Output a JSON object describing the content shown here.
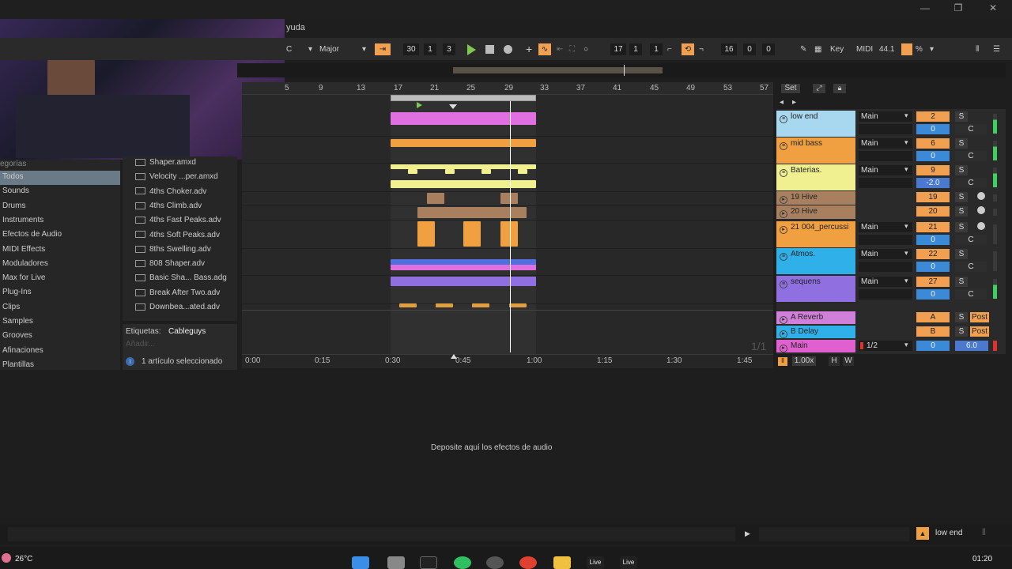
{
  "window": {
    "menu_fragment": "yuda",
    "min": "—",
    "restore": "❐",
    "close": "✕"
  },
  "toolbar": {
    "key": "C",
    "scale": "Major",
    "position": [
      "30",
      "1",
      "3"
    ],
    "loop_start": [
      "17",
      "1",
      "1"
    ],
    "loop_length": [
      "16",
      "0",
      "0"
    ],
    "key_label": "Key",
    "midi_label": "MIDI",
    "cpu": "44.1",
    "cpu_unit": "%"
  },
  "ruler": {
    "bars": [
      "5",
      "9",
      "13",
      "17",
      "21",
      "25",
      "29",
      "33",
      "37",
      "41",
      "45",
      "49",
      "53",
      "57"
    ],
    "set_label": "Set"
  },
  "timeline": {
    "ticks": [
      "0:00",
      "0:15",
      "0:30",
      "0:45",
      "1:00",
      "1:15",
      "1:30",
      "1:45"
    ],
    "page": "1/1"
  },
  "browser": {
    "header": "egorías",
    "categories": [
      "Todos",
      "Sounds",
      "Drums",
      "Instruments",
      "Efectos de Audio",
      "MIDI Effects",
      "Moduladores",
      "Max for Live",
      "Plug-Ins",
      "Clips",
      "Samples",
      "Grooves",
      "Afinaciones",
      "Plantillas"
    ],
    "files": [
      "Shaper.amxd",
      "Velocity ...per.amxd",
      "4ths Choker.adv",
      "4ths Climb.adv",
      "4ths Fast Peaks.adv",
      "4ths Soft Peaks.adv",
      "8ths Swelling.adv",
      "808 Shaper.adv",
      "Basic Sha... Bass.adg",
      "Break After Two.adv",
      "Downbea...ated.adv"
    ],
    "tags_label": "Etiquetas:",
    "tags_value": "Cableguys",
    "add_placeholder": "Añadir...",
    "selected": "1 artículo seleccionado"
  },
  "tracks": [
    {
      "name": "low end",
      "color": "#a8d8f0",
      "route": "Main",
      "num": "2",
      "vol": "0"
    },
    {
      "name": "mid bass",
      "color": "#f0a040",
      "route": "Main",
      "num": "6",
      "vol": "0"
    },
    {
      "name": "Baterias.",
      "color": "#f0f090",
      "route": "Main",
      "num": "9",
      "vol": "-2.0"
    },
    {
      "name": "19 Hive",
      "color": "#a88060",
      "route": "",
      "num": "19",
      "vol": ""
    },
    {
      "name": "20 Hive",
      "color": "#a88060",
      "route": "",
      "num": "20",
      "vol": ""
    },
    {
      "name": "21 004_percussi",
      "color": "#f0a040",
      "route": "Main",
      "num": "21",
      "vol": "0"
    },
    {
      "name": "Atmos.",
      "color": "#30b0e8",
      "route": "Main",
      "num": "22",
      "vol": "0"
    },
    {
      "name": "sequens",
      "color": "#9070e0",
      "route": "Main",
      "num": "27",
      "vol": "0"
    }
  ],
  "returns": [
    {
      "name": "A Reverb",
      "color": "#d080d8",
      "letter": "A",
      "post": "Post"
    },
    {
      "name": "B Delay",
      "color": "#30b0e8",
      "letter": "B",
      "post": "Post"
    },
    {
      "name": "Main",
      "color": "#e060d0",
      "route": "1/2",
      "vol": "0",
      "level": "6.0"
    }
  ],
  "mixer": {
    "solo": "S",
    "center": "C",
    "zoom": "1.00x",
    "h": "H",
    "w": "W"
  },
  "device": {
    "drop_text": "Deposite aquí los efectos de audio"
  },
  "statusbar": {
    "track": "low end"
  },
  "taskbar": {
    "weather": "26°C",
    "clock": "01:20"
  }
}
